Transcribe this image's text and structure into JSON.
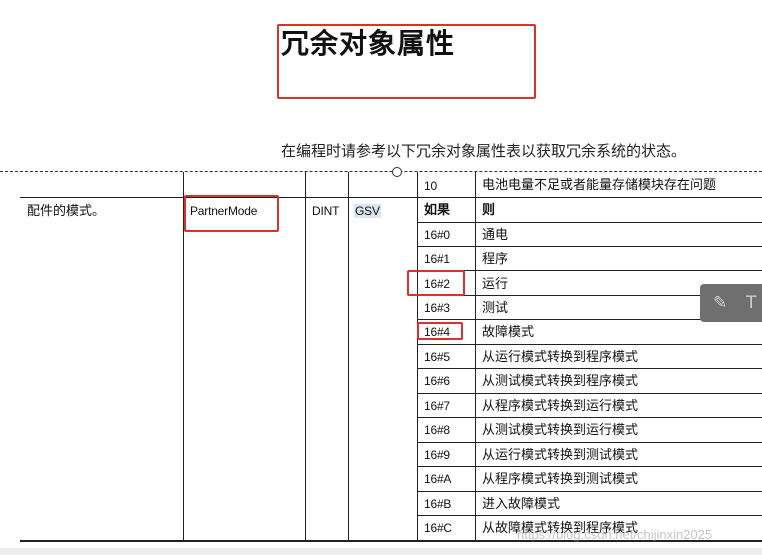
{
  "document": {
    "title": "冗余对象属性",
    "intro": "在编程时请参考以下冗余对象属性表以获取冗余系统的状态。"
  },
  "table": {
    "top_row": {
      "code": "10",
      "meaning": "电池电量不足或者能量存储模块存在问题"
    },
    "attribute": {
      "description": "配件的模式。",
      "name": "PartnerMode",
      "type": "DINT",
      "access": "GSV"
    },
    "header": {
      "if": "如果",
      "then": "则"
    },
    "rows": [
      {
        "code": "16#0",
        "meaning": "通电"
      },
      {
        "code": "16#1",
        "meaning": "程序"
      },
      {
        "code": "16#2",
        "meaning": "运行"
      },
      {
        "code": "16#3",
        "meaning": "测试"
      },
      {
        "code": "16#4",
        "meaning": "故障模式"
      },
      {
        "code": "16#5",
        "meaning": "从运行模式转换到程序模式"
      },
      {
        "code": "16#6",
        "meaning": "从测试模式转换到程序模式"
      },
      {
        "code": "16#7",
        "meaning": "从程序模式转换到运行模式"
      },
      {
        "code": "16#8",
        "meaning": "从测试模式转换到运行模式"
      },
      {
        "code": "16#9",
        "meaning": "从运行模式转换到测试模式"
      },
      {
        "code": "16#A",
        "meaning": "从程序模式转换到测试模式"
      },
      {
        "code": "16#B",
        "meaning": "进入故障模式"
      },
      {
        "code": "16#C",
        "meaning": "从故障模式转换到程序模式"
      }
    ]
  },
  "toolbar": {
    "pen_icon": "pen-icon",
    "other_icon": "text-icon"
  },
  "watermark": "https://blog.csdn.net/chijinxin2025",
  "colors": {
    "annotation": "#d9312b",
    "highlight": "#dce6f2",
    "toolbar": "#6f6f6f"
  }
}
